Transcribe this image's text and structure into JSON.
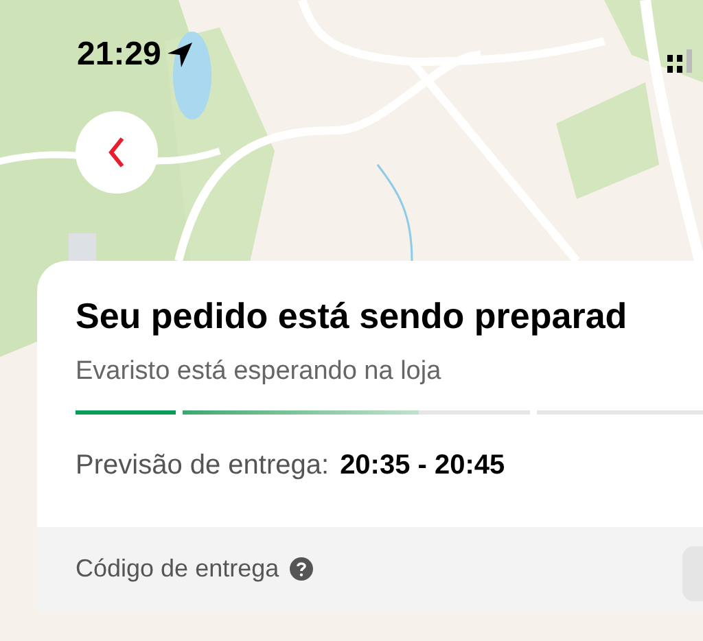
{
  "status_bar": {
    "time": "21:29"
  },
  "order_card": {
    "title": "Seu pedido está sendo preparad",
    "subtitle": "Evaristo está esperando na loja",
    "progress": [
      {
        "level": 1
      },
      {
        "level": 0.68
      },
      {
        "level": 0
      }
    ],
    "estimate_label": "Previsão de entrega:",
    "estimate_value": "20:35 - 20:45",
    "code_label": "Código de entrega"
  }
}
